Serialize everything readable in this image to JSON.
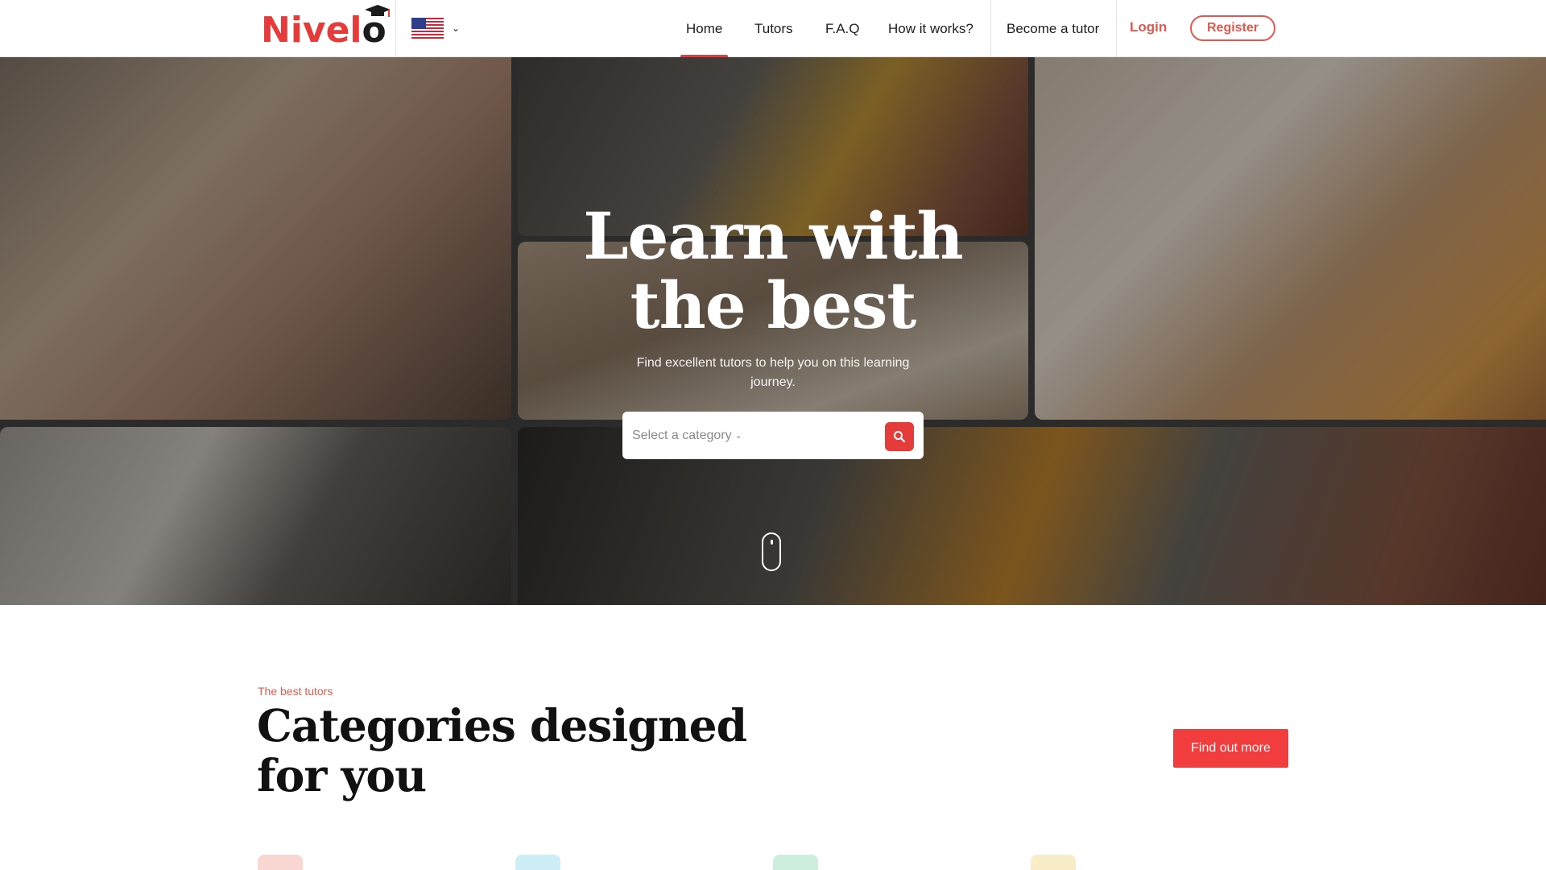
{
  "brand": {
    "name_prefix": "Nivel",
    "name_suffix": "o",
    "accent": "#e63b3b"
  },
  "header": {
    "language_flag": "us-flag-icon",
    "nav": [
      {
        "label": "Home",
        "active": true
      },
      {
        "label": "Tutors",
        "active": false
      },
      {
        "label": "F.A.Q",
        "active": false
      },
      {
        "label": "How it works?",
        "active": false
      },
      {
        "label": "Become a tutor",
        "active": false
      }
    ],
    "login_label": "Login",
    "register_label": "Register"
  },
  "hero": {
    "title_line1": "Learn with",
    "title_line2": "the best",
    "subtitle": "Find excellent tutors to help you on this learning journey.",
    "search_placeholder": "Select a category",
    "search_icon": "search-icon",
    "scroll_icon": "mouse-scroll-icon"
  },
  "categories": {
    "eyebrow": "The best tutors",
    "title": "Categories designed for you",
    "cta_label": "Find out more",
    "icon_colors": [
      "#f9d7d3",
      "#cdeef6",
      "#cdeedd",
      "#f8edc6"
    ]
  }
}
